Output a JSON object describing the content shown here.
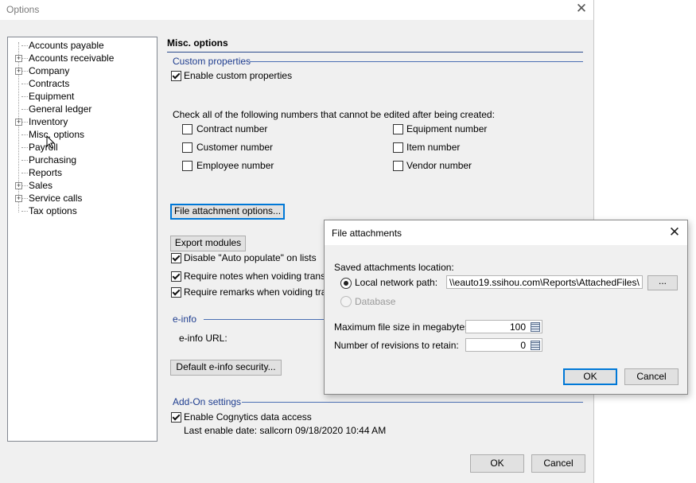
{
  "window": {
    "title": "Options"
  },
  "tree": {
    "items": [
      {
        "label": "Accounts payable",
        "expandable": false
      },
      {
        "label": "Accounts receivable",
        "expandable": true
      },
      {
        "label": "Company",
        "expandable": true
      },
      {
        "label": "Contracts",
        "expandable": false
      },
      {
        "label": "Equipment",
        "expandable": false
      },
      {
        "label": "General ledger",
        "expandable": false
      },
      {
        "label": "Inventory",
        "expandable": true
      },
      {
        "label": "Misc. options",
        "expandable": false,
        "selected": true
      },
      {
        "label": "Payroll",
        "expandable": false
      },
      {
        "label": "Purchasing",
        "expandable": false
      },
      {
        "label": "Reports",
        "expandable": false
      },
      {
        "label": "Sales",
        "expandable": true
      },
      {
        "label": "Service calls",
        "expandable": true
      },
      {
        "label": "Tax options",
        "expandable": false
      }
    ]
  },
  "panel": {
    "title": "Misc. options",
    "custom_properties": {
      "header": "Custom properties",
      "enable_label": "Enable custom properties",
      "enable_checked": true
    },
    "numbers": {
      "instruction": "Check all of the following numbers that cannot be edited after being created:",
      "left": [
        {
          "label": "Contract number",
          "checked": false
        },
        {
          "label": "Customer number",
          "checked": false
        },
        {
          "label": "Employee number",
          "checked": false
        }
      ],
      "right": [
        {
          "label": "Equipment number",
          "checked": false
        },
        {
          "label": "Item number",
          "checked": false
        },
        {
          "label": "Vendor number",
          "checked": false
        }
      ]
    },
    "file_attachment_button": "File attachment options...",
    "export_modules_button": "Export modules",
    "options": [
      {
        "label": "Disable \"Auto populate\" on lists",
        "checked": true
      },
      {
        "label": "Require notes when voiding transactions",
        "checked": true
      },
      {
        "label": "Require remarks when voiding transactions",
        "checked": true
      }
    ],
    "einfo": {
      "header": "e-info",
      "url_label": "e-info URL:",
      "security_button": "Default e-info security..."
    },
    "addon": {
      "header": "Add-On settings",
      "cognytics_label": "Enable Cognytics data access",
      "cognytics_checked": true,
      "last_enable": "Last enable date: sallcorn  09/18/2020 10:44 AM"
    },
    "ok_button": "OK",
    "cancel_button": "Cancel"
  },
  "dialog": {
    "title": "File attachments",
    "location_label": "Saved attachments location:",
    "local_label": "Local network path:",
    "local_path": "\\\\eauto19.ssihou.com\\Reports\\AttachedFiles\\",
    "browse_button": "...",
    "database_label": "Database",
    "max_size_label": "Maximum file size in megabytes:",
    "max_size_value": "100",
    "revisions_label": "Number of revisions to retain:",
    "revisions_value": "0",
    "ok_button": "OK",
    "cancel_button": "Cancel"
  }
}
